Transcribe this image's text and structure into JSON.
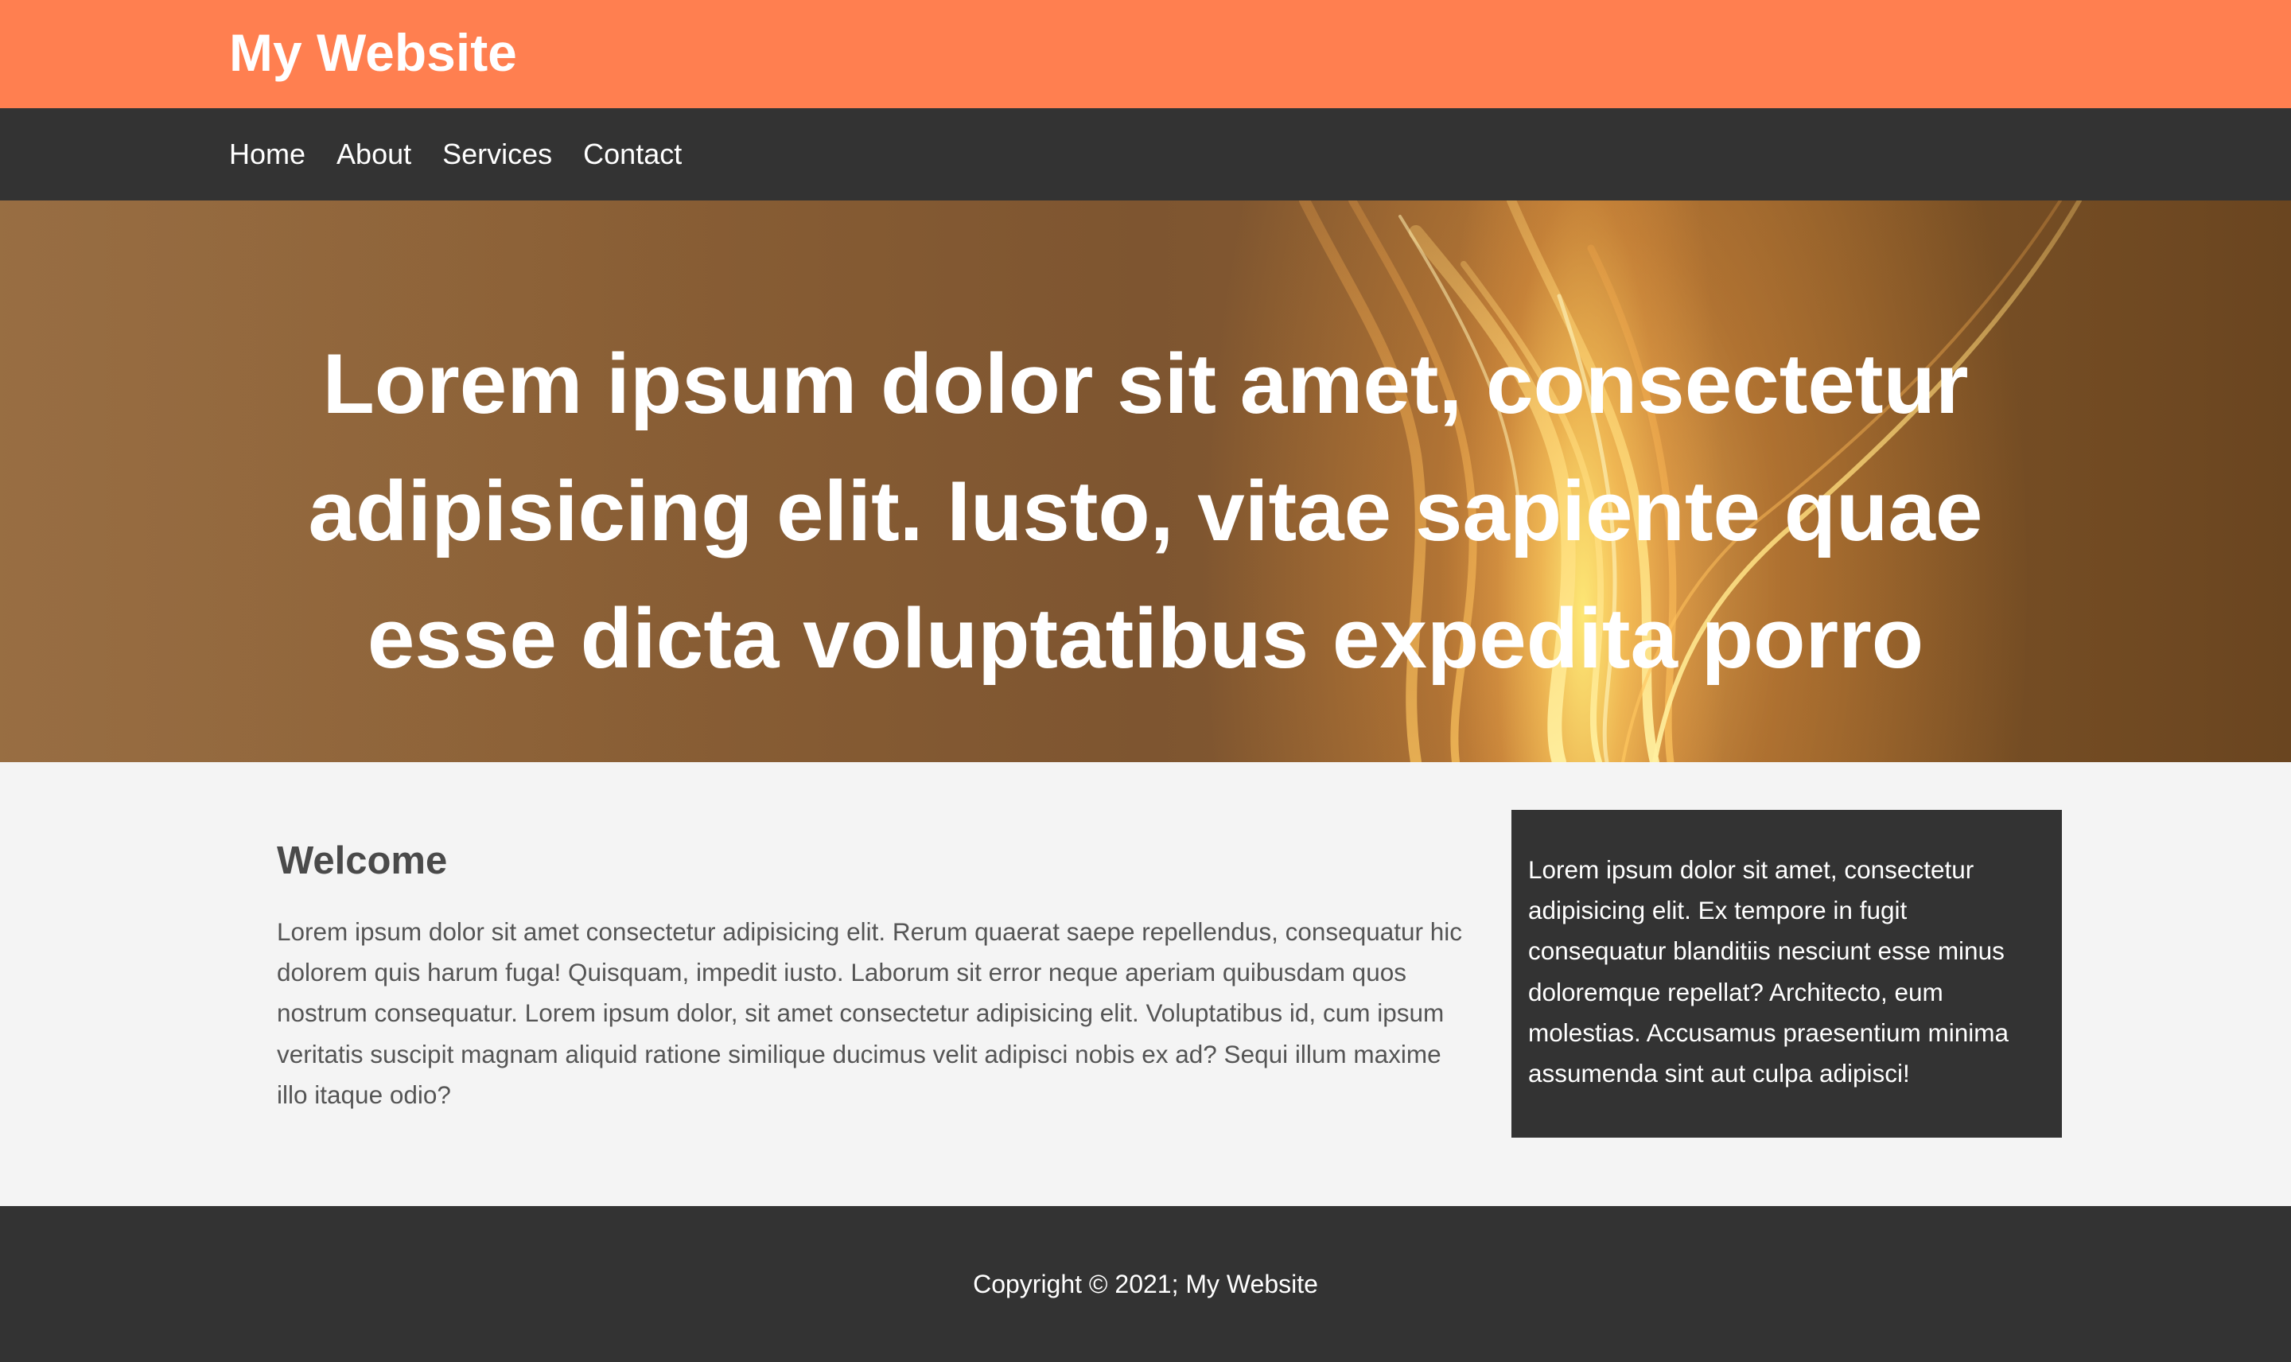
{
  "header": {
    "site_title": "My Website"
  },
  "nav": {
    "items": [
      {
        "label": "Home"
      },
      {
        "label": "About"
      },
      {
        "label": "Services"
      },
      {
        "label": "Contact"
      }
    ]
  },
  "hero": {
    "heading": "Lorem ipsum dolor sit amet, consectetur adipisicing elit. Iusto, vitae sapiente quae esse dicta voluptatibus expedita porro"
  },
  "main": {
    "title": "Welcome",
    "body": "Lorem ipsum dolor sit amet consectetur adipisicing elit. Rerum quaerat saepe repellendus, consequatur hic dolorem quis harum fuga! Quisquam, impedit iusto. Laborum sit error neque aperiam quibusdam quos nostrum consequatur. Lorem ipsum dolor, sit amet consectetur adipisicing elit. Voluptatibus id, cum ipsum veritatis suscipit magnam aliquid ratione similique ducimus velit adipisci nobis ex ad? Sequi illum maxime illo itaque odio?"
  },
  "sidebar": {
    "text": "Lorem ipsum dolor sit amet, consectetur adipisicing elit. Ex tempore in fugit consequatur blanditiis nesciunt esse minus doloremque repellat? Architecto, eum molestias. Accusamus praesentium minima assumenda sint aut culpa adipisci!"
  },
  "footer": {
    "copyright": "Copyright © 2021; My Website"
  },
  "colors": {
    "header_bg": "#ff7f50",
    "nav_bg": "#333333",
    "content_bg": "#f4f4f4",
    "sidebar_bg": "#333333",
    "footer_bg": "#333333",
    "text_light": "#ffffff",
    "text_dark": "#555555"
  }
}
